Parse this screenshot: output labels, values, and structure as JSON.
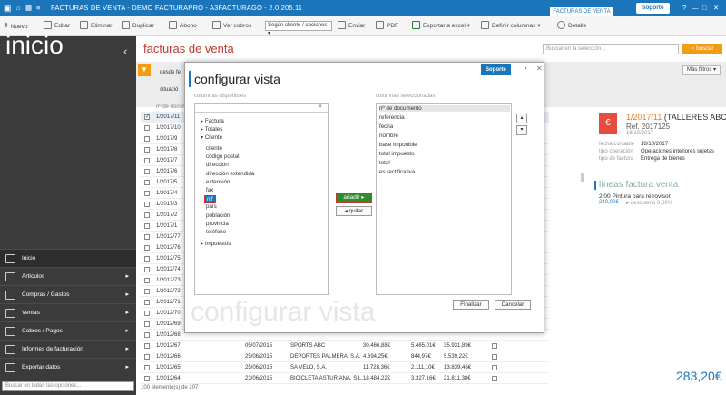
{
  "window": {
    "title": "FACTURAS DE VENTA - DEMO FACTURAPRO - A3FACTURAGO - 2.0.205.11",
    "active_tab": "FACTURAS DE VENTA",
    "soporte": "Soporte"
  },
  "toolbar": {
    "nuevo": "Nuevo",
    "editar": "Editar",
    "eliminar": "Eliminar",
    "duplicar": "Duplicar",
    "abono": "Abono",
    "ver_cobros": "Ver cobros",
    "grouping_select": "Según cliente / opciones",
    "enviar": "Enviar",
    "pdf": "PDF",
    "exportar": "Exportar a excel",
    "definir_columnas": "Definir columnas",
    "detalle": "Detalle"
  },
  "sidebar": {
    "heading": "inicio",
    "items": [
      {
        "label": "Inicio",
        "icon": "home-icon"
      },
      {
        "label": "Artículos",
        "icon": "box-icon"
      },
      {
        "label": "Compras / Gastos",
        "icon": "cart-icon"
      },
      {
        "label": "Ventas",
        "icon": "sales-icon"
      },
      {
        "label": "Cobros / Pagos",
        "icon": "wallet-icon"
      },
      {
        "label": "Informes de facturación",
        "icon": "report-icon"
      },
      {
        "label": "Exportar datos",
        "icon": "export-icon"
      }
    ],
    "search_placeholder": "Buscar en todas las opciones..."
  },
  "main": {
    "title": "facturas de venta",
    "search_placeholder": "Buscar en la selección...",
    "buscar": "buscar",
    "desde_fecha": "desde fe",
    "situacion": "situació",
    "mas_filtros": "Más filtros",
    "col_header": "nº de docum",
    "rows": [
      {
        "num": "1/2017/11",
        "checked": true
      },
      {
        "num": "1/2017/10"
      },
      {
        "num": "1/2017/9"
      },
      {
        "num": "1/2017/8"
      },
      {
        "num": "1/2017/7"
      },
      {
        "num": "1/2017/6"
      },
      {
        "num": "1/2017/5"
      },
      {
        "num": "1/2017/4"
      },
      {
        "num": "1/2017/3"
      },
      {
        "num": "1/2017/2"
      },
      {
        "num": "1/2017/1"
      },
      {
        "num": "1/2012/77"
      },
      {
        "num": "1/2012/76"
      },
      {
        "num": "1/2012/75"
      },
      {
        "num": "1/2012/74"
      },
      {
        "num": "1/2012/73"
      },
      {
        "num": "1/2012/72"
      },
      {
        "num": "1/2012/71"
      },
      {
        "num": "1/2012/70"
      },
      {
        "num": "1/2012/69"
      },
      {
        "num": "1/2012/68"
      },
      {
        "num": "1/2012/67",
        "fecha": "05/07/2015",
        "cliente": "SPORTS ABC",
        "base": "30.466,88€",
        "impuesto": "5.465,01€",
        "total": "35.931,89€"
      },
      {
        "num": "1/2012/66",
        "fecha": "25/06/2015",
        "cliente": "DEPORTES PALMERA, S.A.",
        "base": "4.694,25€",
        "impuesto": "844,97€",
        "total": "5.539,22€"
      },
      {
        "num": "1/2012/65",
        "fecha": "25/06/2015",
        "cliente": "SA VELO, S.A.",
        "base": "11.728,36€",
        "impuesto": "2.111,10€",
        "total": "13.839,46€"
      },
      {
        "num": "1/2012/64",
        "fecha": "23/06/2015",
        "cliente": "BICICLETA ASTURIANA, S.L.",
        "base": "18.484,22€",
        "impuesto": "3.327,16€",
        "total": "21.811,38€"
      }
    ],
    "footer_count": "100 elemento(s) de 207"
  },
  "detail": {
    "title": "1/2017/11",
    "client": "(TALLERES ABC)",
    "ref": "Ref. 2017125",
    "date": "18/10/2017",
    "fecha_contable_label": "fecha contable",
    "fecha_contable": "18/10/2017",
    "tipo_operacion_label": "tipo operación",
    "tipo_operacion": "Operaciones interiores sujetas",
    "tipo_factura_label": "tipo de factura",
    "tipo_factura": "Entrega de bienes",
    "lineas_title": "líneas factura venta",
    "line1": "2,00 Pintura para retrovisor",
    "line1_price": "240,00€",
    "line1_desc": "descuento 0,00%",
    "total": "283,20€"
  },
  "modal": {
    "title": "configurar vista",
    "soporte": "Soporte",
    "available_label": "columnas disponibles",
    "selected_label": "columnas seleccionadas",
    "groups": [
      "Factura",
      "Totales",
      "Cliente",
      "Impuestos"
    ],
    "client_fields": [
      "cliente",
      "código postal",
      "dirección",
      "dirección extendida",
      "extensión",
      "fax",
      "nif",
      "país",
      "población",
      "provincia",
      "teléfono"
    ],
    "selected_item": "nif",
    "selected_columns": [
      "nº de documento",
      "referencia",
      "fecha",
      "nombre",
      "base imponible",
      "total impuesto",
      "total",
      "es rectificativa"
    ],
    "add_button": "añadir",
    "remove_button": "quitar",
    "finalizar": "Finalizar",
    "cancelar": "Cancelar",
    "watermark": "configurar vista"
  }
}
